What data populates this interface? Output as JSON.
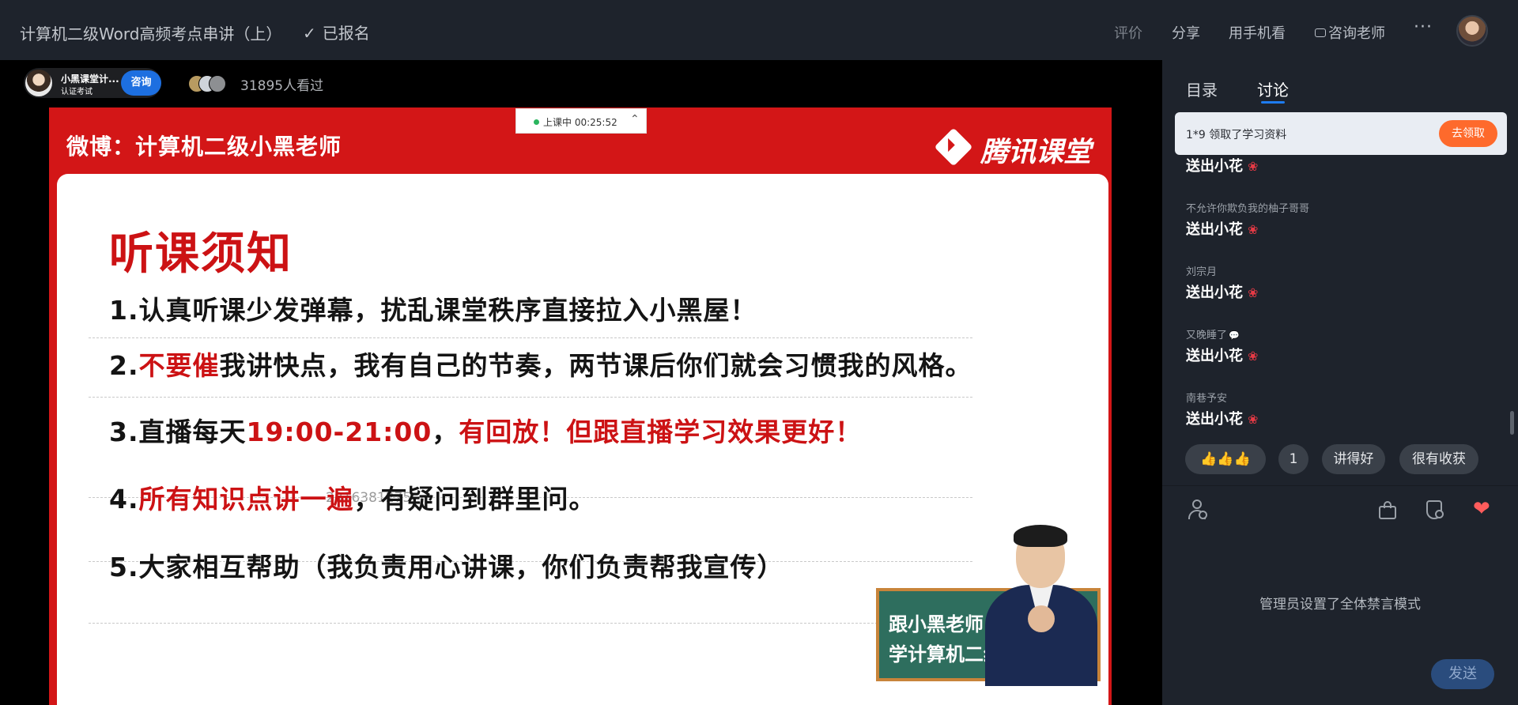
{
  "header": {
    "course_title": "计算机二级Word高频考点串讲（上）",
    "registered_label": "已报名",
    "actions": {
      "rate": "评价",
      "share": "分享",
      "mobile": "用手机看",
      "consult": "咨询老师",
      "more": "···"
    }
  },
  "host": {
    "name": "小黑课堂计...",
    "subtitle": "认证考试",
    "consult_button": "咨询",
    "viewers": "31895人看过"
  },
  "live_status": {
    "text": "上课中 00:25:52"
  },
  "slide": {
    "weibo": "微博：计算机二级小黑老师",
    "brand": "腾讯课堂",
    "title": "听课须知",
    "rules": [
      {
        "a": "1.认真听课少发弹幕，扰乱课堂秩序直接拉入小黑屋！"
      },
      {
        "a": "2.",
        "r1": "不要催",
        "b": "我讲快点，我有自己的节奏，两节课后你们就会习惯我的风格。"
      },
      {
        "a": "3.直播每天",
        "r1": "19:00-21:00",
        "b": "，",
        "r2": "有回放！但跟直播学习效果更好！"
      },
      {
        "a": "4.",
        "r1": "所有知识点讲一遍",
        "b": "，有疑问到群里问。"
      },
      {
        "a": "5.大家相互帮助（我负责用心讲课，你们负责帮我宣传）"
      }
    ],
    "watermark": "2816381275",
    "board_line1": "跟小黑老师",
    "board_line2": "学计算机二级"
  },
  "sidebar": {
    "tabs": [
      "目录",
      "讨论"
    ],
    "active_tab": "讨论",
    "notice": {
      "text": "1*9  领取了学习资料",
      "button": "去领取"
    },
    "messages": [
      {
        "user": "",
        "text": "送出小花"
      },
      {
        "user": "不允许你欺负我的柚子哥哥",
        "text": "送出小花"
      },
      {
        "user": "刘宗月",
        "text": "送出小花"
      },
      {
        "user": "又晚睡了",
        "text": "送出小花"
      },
      {
        "user": "南巷予安",
        "text": "送出小花"
      }
    ],
    "quick_replies": [
      "👍👍👍",
      "1",
      "讲得好",
      "很有收获"
    ],
    "mute_notice": "管理员设置了全体禁言模式",
    "send_button": "发送"
  },
  "colors": {
    "accent": "#1e7cf0",
    "slide_red": "#d31617",
    "claim_orange": "#fe6a2c"
  },
  "icons": [
    "check-icon",
    "chat-bubble-icon",
    "more-icon",
    "user-avatar",
    "flower-icon",
    "speech-icon",
    "user-tool-icon",
    "bag-icon",
    "shield-icon",
    "heart-icon"
  ]
}
